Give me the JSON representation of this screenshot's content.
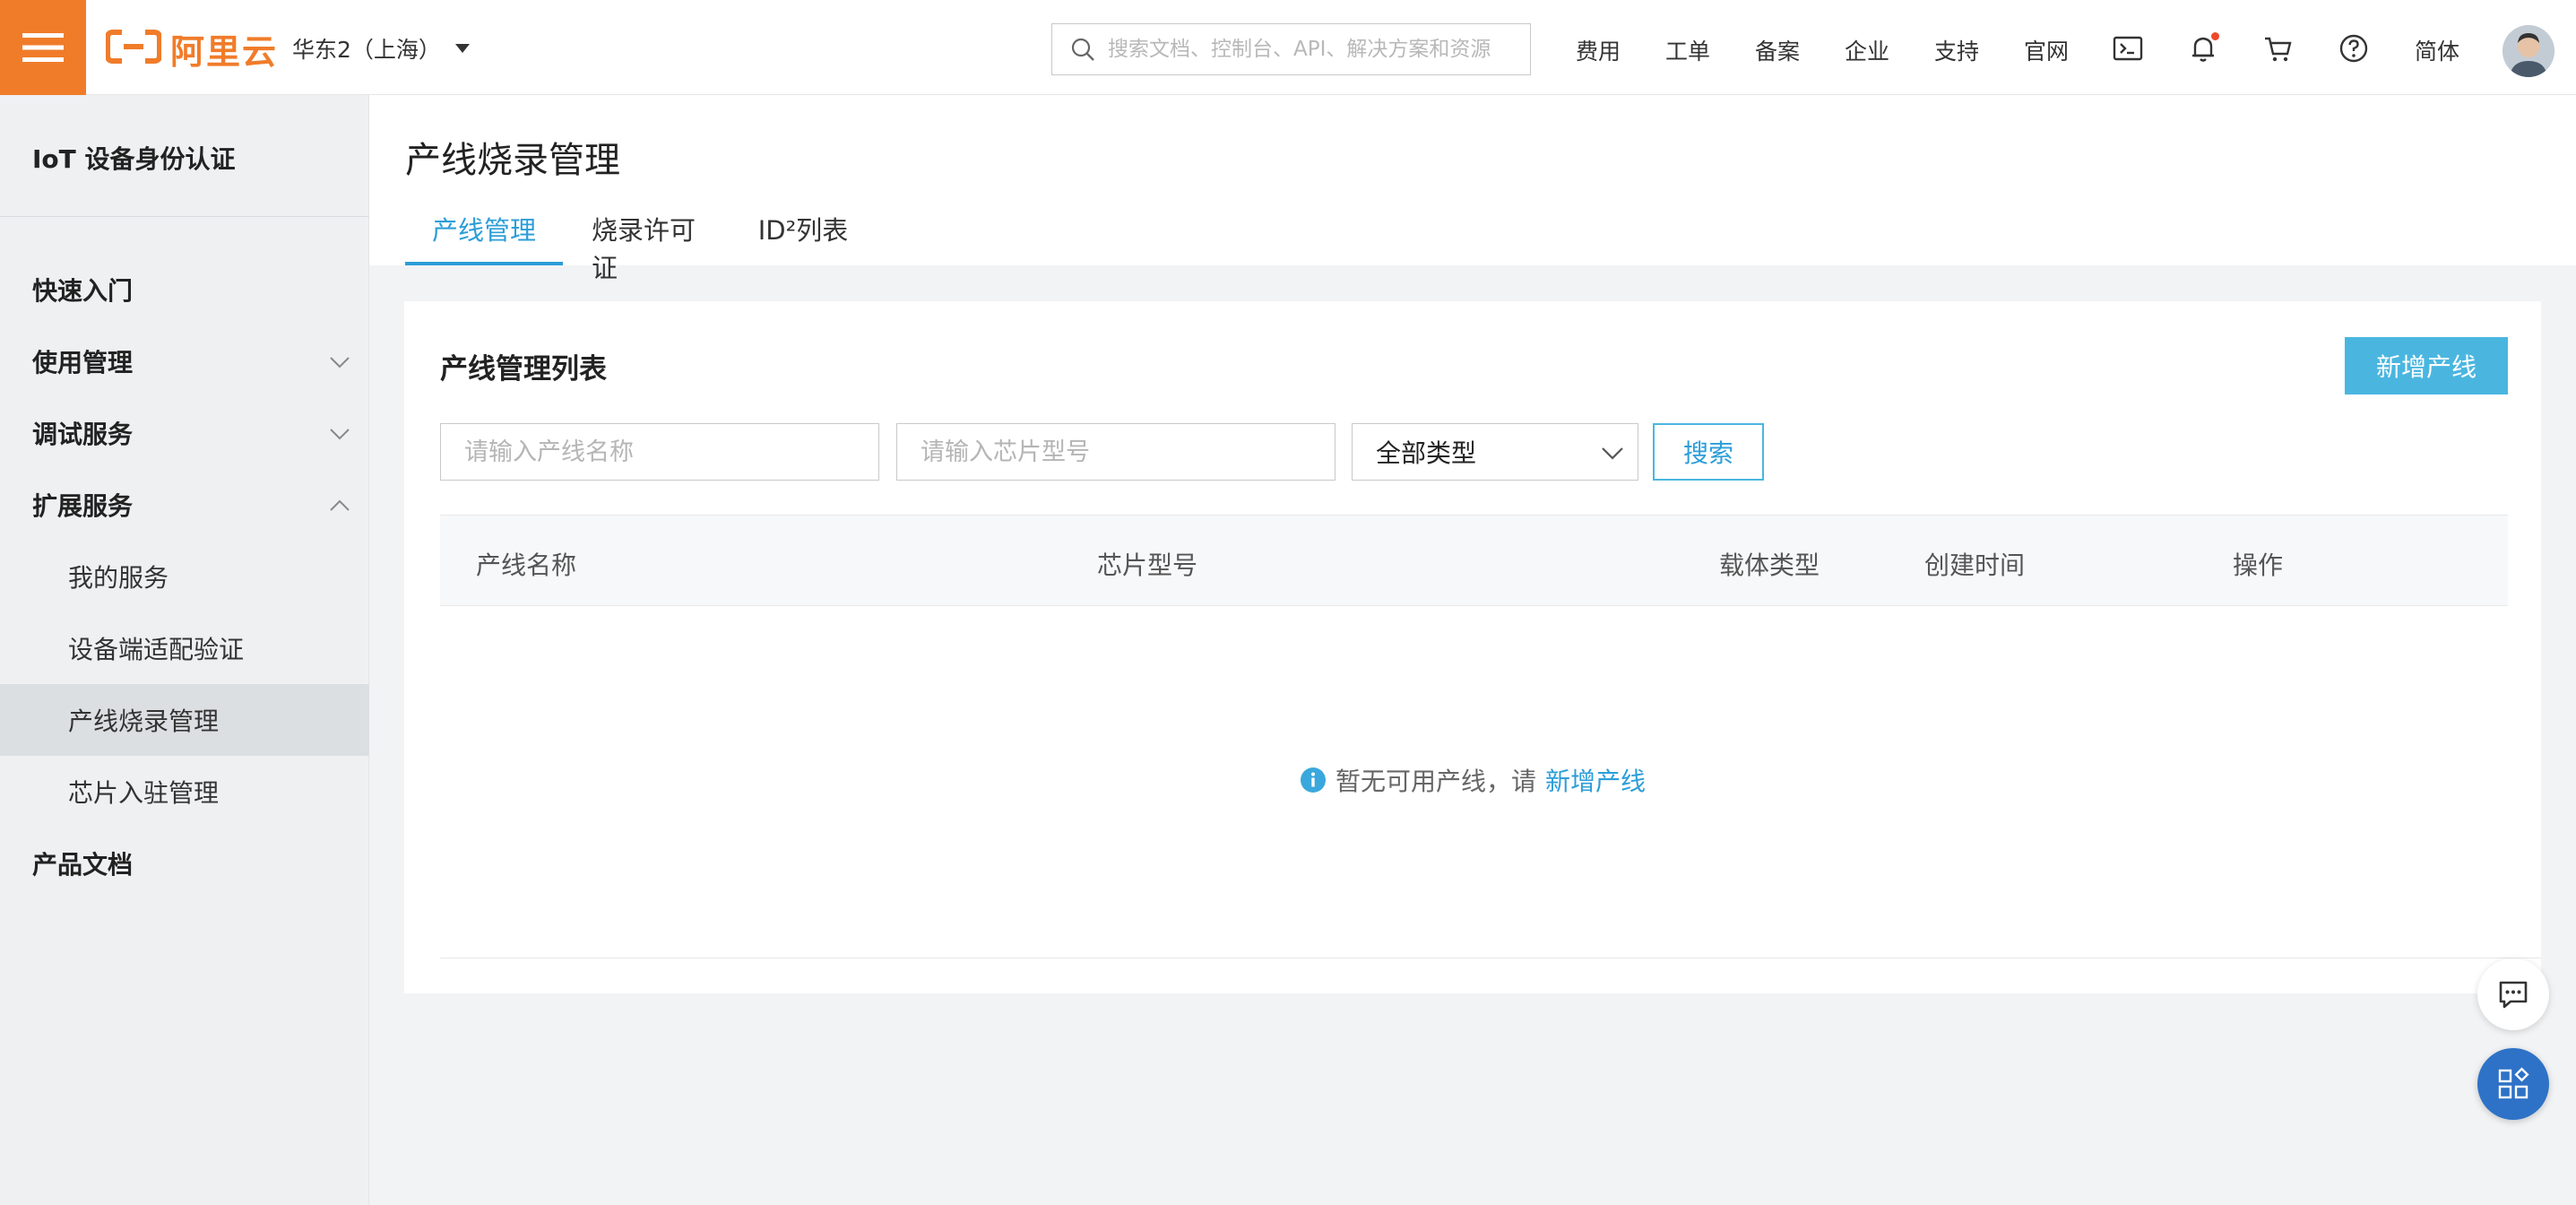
{
  "header": {
    "logo_text": "阿里云",
    "region": "华东2（上海）",
    "search_placeholder": "搜索文档、控制台、API、解决方案和资源",
    "nav": [
      "费用",
      "工单",
      "备案",
      "企业",
      "支持",
      "官网"
    ],
    "lang": "简体"
  },
  "sidebar": {
    "title": "IoT 设备身份认证",
    "items": [
      {
        "label": "快速入门"
      },
      {
        "label": "使用管理"
      },
      {
        "label": "调试服务"
      },
      {
        "label": "扩展服务"
      }
    ],
    "subitems": [
      {
        "label": "我的服务"
      },
      {
        "label": "设备端适配验证"
      },
      {
        "label": "产线烧录管理"
      },
      {
        "label": "芯片入驻管理"
      }
    ],
    "docs": "产品文档"
  },
  "page": {
    "title": "产线烧录管理",
    "tabs": [
      "产线管理",
      "烧录许可证",
      "ID²列表"
    ]
  },
  "panel": {
    "title": "产线管理列表",
    "add_button": "新增产线",
    "name_placeholder": "请输入产线名称",
    "chip_placeholder": "请输入芯片型号",
    "type_select": "全部类型",
    "search_button": "搜索",
    "columns": [
      "产线名称",
      "芯片型号",
      "载体类型",
      "创建时间",
      "操作"
    ],
    "empty_text": "暂无可用产线，请",
    "empty_link": "新增产线"
  },
  "colors": {
    "brand": "#f07c2a",
    "accent": "#2c9ed8",
    "button": "#4ab6e0"
  }
}
